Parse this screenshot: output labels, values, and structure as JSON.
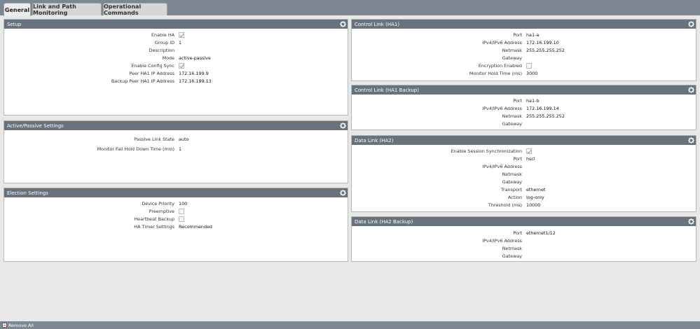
{
  "tabs": [
    {
      "label": "General",
      "active": true
    },
    {
      "label": "Link and Path Monitoring",
      "active": false
    },
    {
      "label": "Operational Commands",
      "active": false
    }
  ],
  "setup": {
    "title": "Setup",
    "enable_ha_label": "Enable HA",
    "enable_ha": true,
    "group_id_label": "Group ID",
    "group_id": "1",
    "description_label": "Description",
    "description": "",
    "mode_label": "Mode",
    "mode": "active-passive",
    "config_sync_label": "Enable Config Sync",
    "config_sync": true,
    "peer_ip_label": "Peer HA1 IP Address",
    "peer_ip": "172.16.199.9",
    "backup_peer_ip_label": "Backup Peer HA1 IP Address",
    "backup_peer_ip": "172.16.199.13"
  },
  "active_passive": {
    "title": "Active/Passive Settings",
    "passive_link_label": "Passive Link State",
    "passive_link": "auto",
    "monitor_fail_label": "Monitor Fail Hold Down Time (min)",
    "monitor_fail": "1"
  },
  "election": {
    "title": "Election Settings",
    "device_priority_label": "Device Priority",
    "device_priority": "100",
    "preemptive_label": "Preemptive",
    "preemptive": false,
    "heartbeat_label": "Heartbeat Backup",
    "heartbeat": false,
    "timer_label": "HA Timer Settings",
    "timer": "Recommended"
  },
  "ha1": {
    "title": "Control Link (HA1)",
    "port_label": "Port",
    "port": "ha1-a",
    "ip_label": "IPv4/IPv6 Address",
    "ip": "172.16.199.10",
    "netmask_label": "Netmask",
    "netmask": "255.255.255.252",
    "gateway_label": "Gateway",
    "gateway": "",
    "encryption_label": "Encryption Enabled",
    "encryption": false,
    "hold_time_label": "Monitor Hold Time (ms)",
    "hold_time": "3000"
  },
  "ha1_backup": {
    "title": "Control Link (HA1 Backup)",
    "port_label": "Port",
    "port": "ha1-b",
    "ip_label": "IPv4/IPv6 Address",
    "ip": "172.16.199.14",
    "netmask_label": "Netmask",
    "netmask": "255.255.255.252",
    "gateway_label": "Gateway",
    "gateway": ""
  },
  "ha2": {
    "title": "Data Link (HA2)",
    "session_sync_label": "Enable Session Synchronization",
    "session_sync": true,
    "port_label": "Port",
    "port": "hsci",
    "ip_label": "IPv4/IPv6 Address",
    "ip": "",
    "netmask_label": "Netmask",
    "netmask": "",
    "gateway_label": "Gateway",
    "gateway": "",
    "transport_label": "Transport",
    "transport": "ethernet",
    "action_label": "Action",
    "action": "log-only",
    "threshold_label": "Threshold (ms)",
    "threshold": "10000"
  },
  "ha2_backup": {
    "title": "Data Link (HA2 Backup)",
    "port_label": "Port",
    "port": "ethernet1/12",
    "ip_label": "IPv4/IPv6 Address",
    "ip": "",
    "netmask_label": "Netmask",
    "netmask": "",
    "gateway_label": "Gateway",
    "gateway": ""
  },
  "footer": {
    "remove_all": "Remove All"
  },
  "colors": {
    "header": "#67727d",
    "tabbar": "#7d8791",
    "background": "#e8e8e8"
  },
  "icons": {
    "panel_action": "gear-icon",
    "footer_action": "remove-all-icon"
  }
}
